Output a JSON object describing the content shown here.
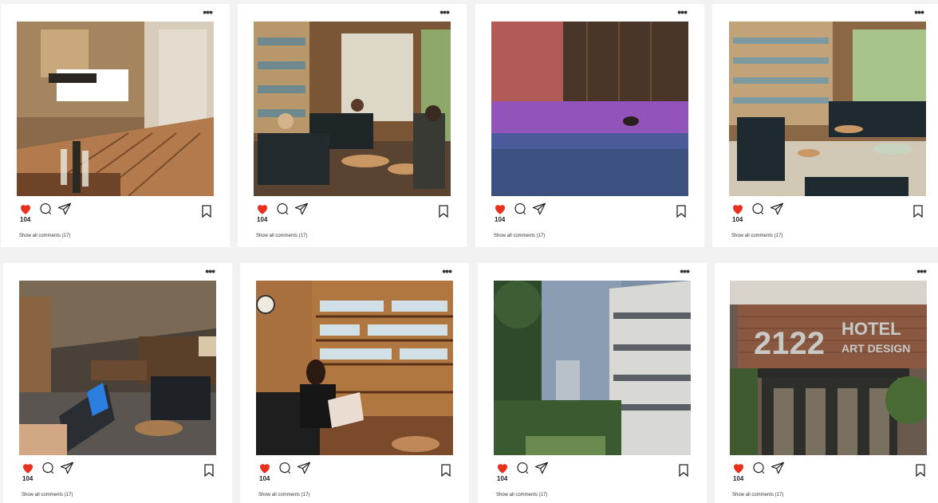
{
  "posts": [
    {
      "likes": "104",
      "comments_link": "Show all comments (17)",
      "scene": "bedroom-balcony"
    },
    {
      "likes": "104",
      "comments_link": "Show all comments (17)",
      "scene": "library-lounge-people"
    },
    {
      "likes": "104",
      "comments_link": "Show all comments (17)",
      "scene": "night-pool"
    },
    {
      "likes": "104",
      "comments_link": "Show all comments (17)",
      "scene": "library-lounge-empty"
    },
    {
      "likes": "104",
      "comments_link": "Show all comments (17)",
      "scene": "lobby-laptop"
    },
    {
      "likes": "104",
      "comments_link": "Show all comments (17)",
      "scene": "reading-woman"
    },
    {
      "likes": "104",
      "comments_link": "Show all comments (17)",
      "scene": "building-exterior"
    },
    {
      "likes": "104",
      "comments_link": "Show all comments (17)",
      "scene": "hotel-facade",
      "sign": {
        "number": "2122",
        "name": "HOTEL",
        "tagline": "ART DESIGN"
      }
    }
  ],
  "icons": {
    "more": "more-options-icon",
    "like": "heart-filled-icon",
    "comment": "comment-icon",
    "share": "send-icon",
    "save": "bookmark-icon"
  },
  "colors": {
    "heart": "#e8301c",
    "card": "#ffffff",
    "background": "#f2f2f2"
  }
}
